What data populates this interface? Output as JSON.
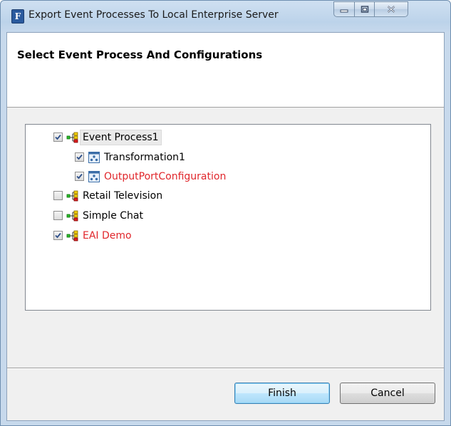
{
  "window": {
    "title": "Export Event Processes To Local Enterprise Server",
    "app_icon_letter": "F"
  },
  "header": {
    "title": "Select Event Process And Configurations"
  },
  "tree": {
    "items": [
      {
        "label": "Event Process1",
        "checked": true,
        "level": 0,
        "icon": "event-process-icon",
        "color": "#000000"
      },
      {
        "label": "Transformation1",
        "checked": true,
        "level": 1,
        "icon": "configuration-icon",
        "color": "#000000"
      },
      {
        "label": "OutputPortConfiguration",
        "checked": true,
        "level": 1,
        "icon": "configuration-icon",
        "color": "#e0262b"
      },
      {
        "label": "Retail Television",
        "checked": false,
        "level": 0,
        "icon": "event-process-icon",
        "color": "#000000"
      },
      {
        "label": "Simple Chat",
        "checked": false,
        "level": 0,
        "icon": "event-process-icon",
        "color": "#000000"
      },
      {
        "label": "EAI Demo",
        "checked": true,
        "level": 0,
        "icon": "event-process-icon",
        "color": "#e0262b"
      }
    ]
  },
  "buttons": {
    "finish": "Finish",
    "cancel": "Cancel"
  },
  "colors": {
    "error_text": "#e0262b",
    "default_button_border": "#3c7fb1"
  }
}
